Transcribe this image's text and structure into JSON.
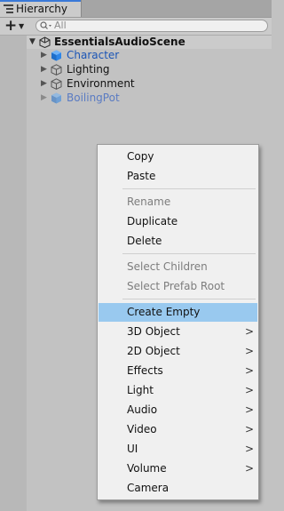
{
  "window": {
    "tab_label": "Hierarchy"
  },
  "toolbar": {
    "add_label": "+",
    "search_placeholder": "All"
  },
  "hierarchy": {
    "scene_name": "EssentialsAudioScene",
    "items": [
      {
        "label": "Character",
        "icon": "prefab-cube-icon"
      },
      {
        "label": "Lighting",
        "icon": "gameobject-cube-icon"
      },
      {
        "label": "Environment",
        "icon": "gameobject-cube-icon"
      },
      {
        "label": "BoilingPot",
        "icon": "prefab-cube-icon"
      }
    ]
  },
  "context_menu": {
    "items": [
      {
        "label": "Copy",
        "enabled": true,
        "submenu": false
      },
      {
        "label": "Paste",
        "enabled": true,
        "submenu": false
      },
      {
        "label": "Rename",
        "enabled": false,
        "submenu": false
      },
      {
        "label": "Duplicate",
        "enabled": true,
        "submenu": false
      },
      {
        "label": "Delete",
        "enabled": true,
        "submenu": false
      },
      {
        "label": "Select Children",
        "enabled": false,
        "submenu": false
      },
      {
        "label": "Select Prefab Root",
        "enabled": false,
        "submenu": false
      },
      {
        "label": "Create Empty",
        "enabled": true,
        "submenu": false,
        "highlighted": true
      },
      {
        "label": "3D Object",
        "enabled": true,
        "submenu": true
      },
      {
        "label": "2D Object",
        "enabled": true,
        "submenu": true
      },
      {
        "label": "Effects",
        "enabled": true,
        "submenu": true
      },
      {
        "label": "Light",
        "enabled": true,
        "submenu": true
      },
      {
        "label": "Audio",
        "enabled": true,
        "submenu": true
      },
      {
        "label": "Video",
        "enabled": true,
        "submenu": true
      },
      {
        "label": "UI",
        "enabled": true,
        "submenu": true
      },
      {
        "label": "Volume",
        "enabled": true,
        "submenu": true
      },
      {
        "label": "Camera",
        "enabled": true,
        "submenu": false
      }
    ],
    "submenu_glyph": ">"
  },
  "colors": {
    "highlight": "#99c9ef",
    "prefab_blue": "#1b55b6",
    "tab_accent": "#3a79d8"
  }
}
